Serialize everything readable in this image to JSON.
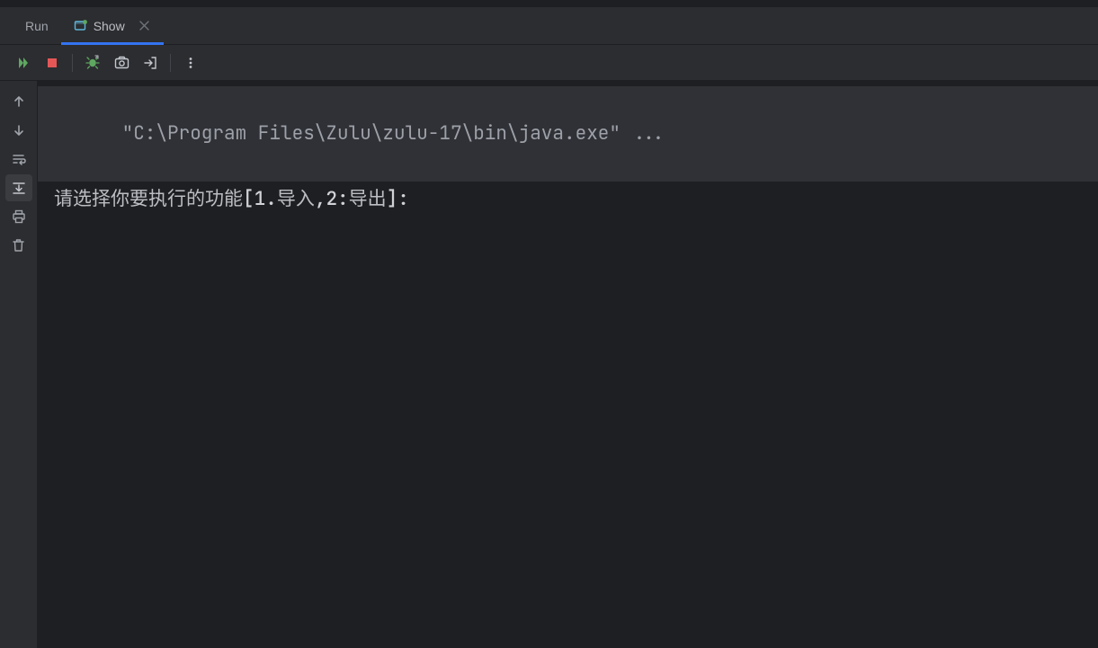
{
  "tabs": {
    "run": {
      "label": "Run"
    },
    "show": {
      "label": "Show"
    }
  },
  "console": {
    "command_line": "\"C:\\Program Files\\Zulu\\zulu-17\\bin\\java.exe\" ...",
    "prompt_prefix": "请选择你要执行的功能",
    "prompt_bracket_open": "[",
    "prompt_opt1_num": "1",
    "prompt_opt1_dot": ".",
    "prompt_opt1_label": "导入",
    "prompt_comma": ",",
    "prompt_opt2_num": "2",
    "prompt_opt2_colon": ":",
    "prompt_opt2_label": "导出",
    "prompt_bracket_close": "]",
    "prompt_end": ":"
  }
}
